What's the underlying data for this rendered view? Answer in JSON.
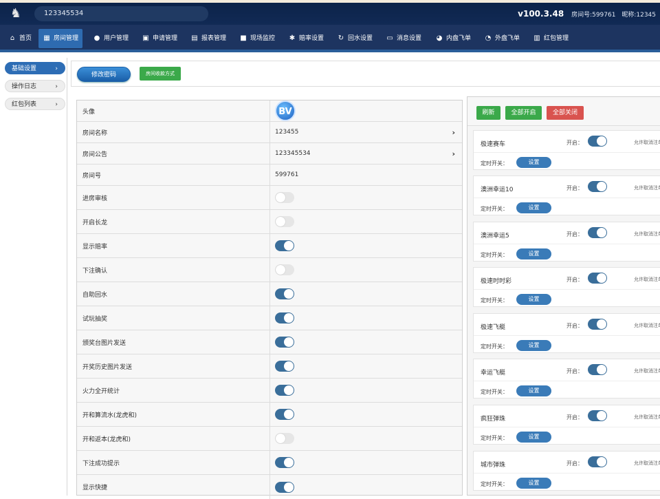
{
  "header": {
    "room_display": "123345534",
    "version": "v100.3.48",
    "room_no_label": "房间号:599761",
    "nickname_label": "昵称:12345"
  },
  "nav": [
    {
      "label": "首页",
      "icon": "home-icon"
    },
    {
      "label": "房间管理",
      "icon": "building-icon",
      "active": true
    },
    {
      "label": "用户管理",
      "icon": "users-icon"
    },
    {
      "label": "申请管理",
      "icon": "apply-icon"
    },
    {
      "label": "报表管理",
      "icon": "calendar-icon"
    },
    {
      "label": "现场监控",
      "icon": "camera-icon"
    },
    {
      "label": "赔率设置",
      "icon": "gear-icon"
    },
    {
      "label": "回水设置",
      "icon": "refresh-icon"
    },
    {
      "label": "消息设置",
      "icon": "message-icon"
    },
    {
      "label": "内盘飞单",
      "icon": "palette-icon"
    },
    {
      "label": "外盘飞单",
      "icon": "palette-outline-icon"
    },
    {
      "label": "红包管理",
      "icon": "redpacket-icon"
    }
  ],
  "sidebar": [
    {
      "label": "基础设置",
      "active": true
    },
    {
      "label": "操作日志"
    },
    {
      "label": "红包列表"
    }
  ],
  "toolbar": {
    "edit_password": "修改密码",
    "payment_method": "房间收款方式"
  },
  "settings": [
    {
      "label": "头像",
      "avatar_text": "BV"
    },
    {
      "label": "房间名称",
      "value": "123455",
      "arrow": true
    },
    {
      "label": "房间公告",
      "value": "123345534",
      "arrow": true
    },
    {
      "label": "房间号",
      "value": "599761"
    },
    {
      "label": "进房审核",
      "toggle": false
    },
    {
      "label": "开启长龙",
      "toggle": false
    },
    {
      "label": "显示赔率",
      "toggle": true
    },
    {
      "label": "下注确认",
      "toggle": false
    },
    {
      "label": "自助回水",
      "toggle": true
    },
    {
      "label": "试玩抽奖",
      "toggle": true
    },
    {
      "label": "颁奖台图片发送",
      "toggle": true
    },
    {
      "label": "开奖历史图片发送",
      "toggle": true
    },
    {
      "label": "火力全开统计",
      "toggle": true
    },
    {
      "label": "开和算流水(龙虎和)",
      "toggle": true
    },
    {
      "label": "开和返本(龙虎和)",
      "toggle": false
    },
    {
      "label": "下注成功提示",
      "toggle": true
    },
    {
      "label": "显示快捷",
      "toggle": true
    }
  ],
  "panel": {
    "refresh": "刷新",
    "open_all": "全部开启",
    "close_all": "全部关闭",
    "open_label": "开启：",
    "allow_label": "允许取消注单",
    "timer_label": "定时开关：",
    "set_label": "设置",
    "games": [
      {
        "name": "极速赛车",
        "on": true
      },
      {
        "name": "澳洲幸运10",
        "on": true
      },
      {
        "name": "澳洲幸运5",
        "on": true
      },
      {
        "name": "极速时时彩",
        "on": true
      },
      {
        "name": "极速飞艇",
        "on": true
      },
      {
        "name": "幸运飞艇",
        "on": true
      },
      {
        "name": "疯狂弹珠",
        "on": true
      },
      {
        "name": "城市弹珠",
        "on": true
      }
    ]
  },
  "colors": {
    "header_bg": "#0c2349",
    "nav_bg": "#1d3460",
    "active_tab": "#2e6bb0",
    "toggle_on": "#3a6e9a",
    "green": "#3ba94a",
    "red": "#d9534f"
  }
}
